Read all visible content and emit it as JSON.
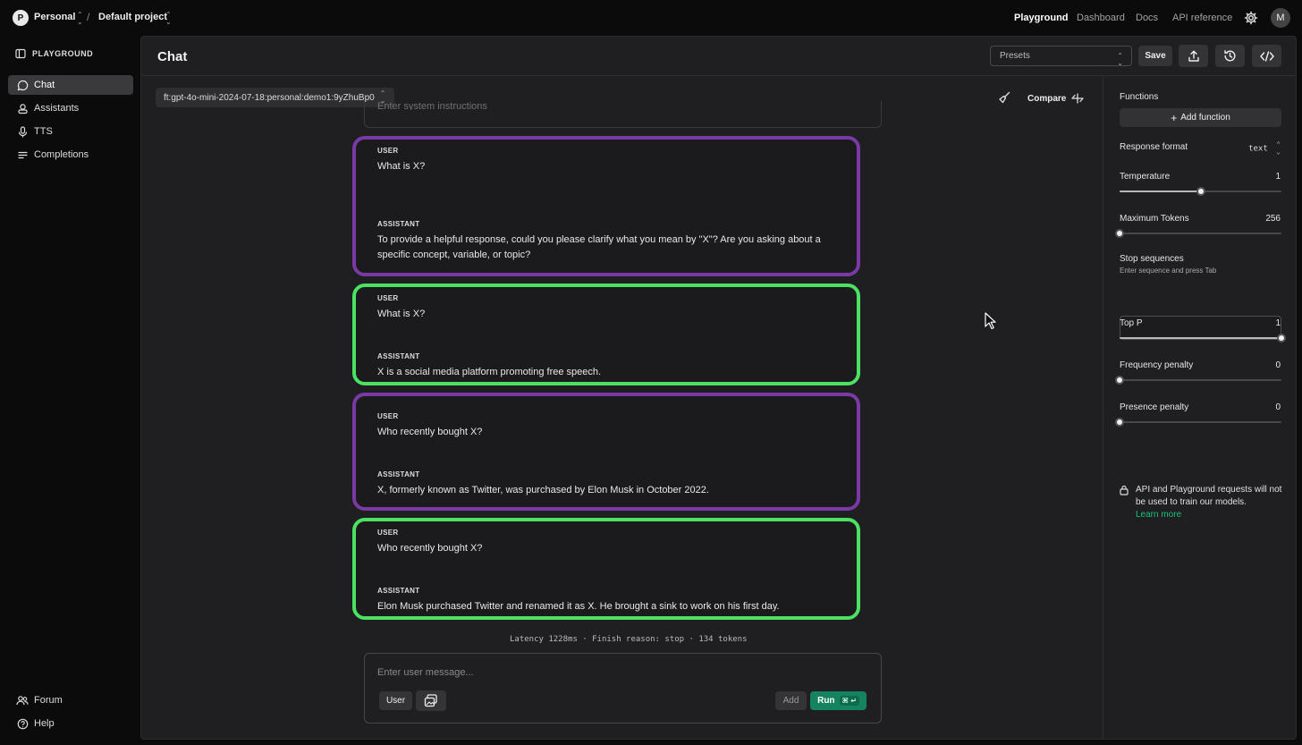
{
  "topbar": {
    "org_initial": "P",
    "org_name": "Personal",
    "separator": "/",
    "project_name": "Default project",
    "nav": [
      "Playground",
      "Dashboard",
      "Docs",
      "API reference"
    ],
    "user_initial": "M"
  },
  "sidebar": {
    "header": "PLAYGROUND",
    "items": [
      {
        "label": "Chat",
        "icon": "chat-bubble-icon",
        "active": true
      },
      {
        "label": "Assistants",
        "icon": "assistant-icon",
        "active": false
      },
      {
        "label": "TTS",
        "icon": "microphone-icon",
        "active": false
      },
      {
        "label": "Completions",
        "icon": "lines-icon",
        "active": false
      }
    ],
    "footer": [
      {
        "label": "Forum",
        "icon": "people-icon"
      },
      {
        "label": "Help",
        "icon": "question-icon"
      }
    ]
  },
  "header": {
    "title": "Chat",
    "presets_placeholder": "Presets",
    "save_label": "Save"
  },
  "chat": {
    "model": "ft:gpt-4o-mini-2024-07-18:personal:demo1:9yZhuBp0",
    "compare_label": "Compare",
    "system_placeholder": "Enter system instructions",
    "conversations": [
      {
        "user_role": "USER",
        "user_text": "What is X?",
        "assistant_role": "ASSISTANT",
        "assistant_text": "To provide a helpful response, could you please clarify what you mean by \"X\"? Are you asking about a specific concept, variable, or topic?"
      },
      {
        "user_role": "USER",
        "user_text": "What is X?",
        "assistant_role": "ASSISTANT",
        "assistant_text": "X is a social media platform promoting free speech."
      },
      {
        "user_role": "USER",
        "user_text": "Who recently bought X?",
        "assistant_role": "ASSISTANT",
        "assistant_text": "X, formerly known as Twitter, was purchased by Elon Musk in October 2022."
      },
      {
        "user_role": "USER",
        "user_text": "Who recently bought X?",
        "assistant_role": "ASSISTANT",
        "assistant_text": "Elon Musk purchased Twitter and renamed it as X.  He brought a sink to work on his first day."
      }
    ],
    "latency_line": "Latency 1228ms · Finish reason: stop · 134 tokens",
    "composer": {
      "placeholder": "Enter user message...",
      "role_label": "User",
      "add_label": "Add",
      "run_label": "Run",
      "run_shortcut": "⌘ ↵"
    }
  },
  "settings": {
    "functions_label": "Functions",
    "add_function_label": "Add function",
    "response_format_label": "Response format",
    "response_format_value": "text",
    "temperature_label": "Temperature",
    "temperature_value": "1",
    "temperature_fraction": 0.5,
    "max_tokens_label": "Maximum Tokens",
    "max_tokens_value": "256",
    "max_tokens_fraction": 0.0,
    "stop_sequences_label": "Stop sequences",
    "stop_sequences_hint": "Enter sequence and press Tab",
    "top_p_label": "Top P",
    "top_p_value": "1",
    "top_p_fraction": 1.0,
    "frequency_penalty_label": "Frequency penalty",
    "frequency_penalty_value": "0",
    "frequency_penalty_fraction": 0.0,
    "presence_penalty_label": "Presence penalty",
    "presence_penalty_value": "0",
    "presence_penalty_fraction": 0.0,
    "notice_text": "API and Playground requests will not be used to train our models.",
    "learn_more": "Learn more"
  },
  "colors": {
    "accent_green": "#16835f",
    "link_green": "#19c37d",
    "purple_border": "#7a3aa6",
    "green_border": "#4de164"
  }
}
